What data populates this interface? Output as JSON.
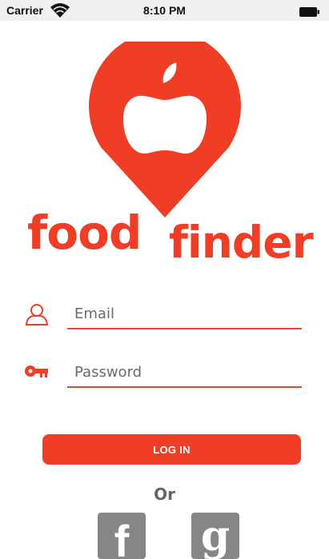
{
  "status_bar": {
    "carrier": "Carrier",
    "time": "8:10 PM"
  },
  "brand": {
    "word1": "food",
    "word2": "finder",
    "color": "#f03d26"
  },
  "login_form": {
    "email_placeholder": "Email",
    "password_placeholder": "Password",
    "login_button": "LOG IN"
  },
  "divider_text": "Or",
  "social": {
    "facebook_glyph": "f",
    "google_glyph": "g",
    "tile_color": "#868686"
  },
  "icons": [
    "wifi-icon",
    "battery-icon",
    "apple-map-pin-logo",
    "user-icon",
    "key-icon",
    "facebook-icon",
    "google-icon"
  ]
}
